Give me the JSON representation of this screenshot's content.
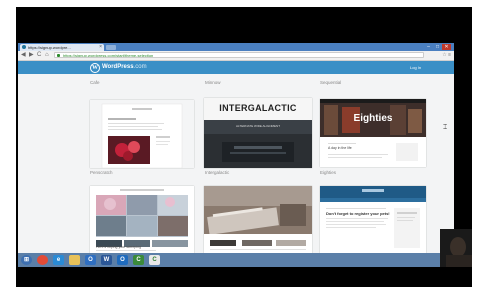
{
  "browser": {
    "tab_title": "https://signup.wordpre...",
    "tab_close": "×",
    "window_buttons": [
      "–",
      "□",
      "✕"
    ],
    "nav": {
      "back": "◀",
      "forward": "▶",
      "reload": "C",
      "home": "⌂"
    },
    "url": "https://signup.wordpress.com/start/theme-selection",
    "toolbar_icons": "☆ ≡"
  },
  "wp_header": {
    "logo_letter": "W",
    "brand": "WordPress",
    "brand_suffix": ".com",
    "login_label": "Log In"
  },
  "themes": [
    {
      "label": "Cafe"
    },
    {
      "label": "Minnow"
    },
    {
      "label": "Sequential"
    },
    {
      "label": "Penscratch"
    },
    {
      "label": "Intergalactic"
    },
    {
      "label": "Eighties"
    }
  ],
  "theme_previews": {
    "intergalactic_title": "INTERGALACTIC",
    "intergalactic_sub": "ALTERNATE WIDE ALIGNMENT",
    "eighties_title": "Eighties",
    "eighties_sub": "A day in the life",
    "penscratch_heading": "Here's hoping your sweeping",
    "sequential_post": "Don't forget to register your pets!"
  },
  "taskbar_icons": [
    "start-orb",
    "chrome",
    "ie",
    "explorer",
    "outlook",
    "word",
    "outlook-2",
    "camtasia",
    "chrome-2"
  ],
  "colors": {
    "wp_blue": "#3a8fc6",
    "tab_blue": "#4a7fc0",
    "taskbar": "#5b7fa8"
  }
}
